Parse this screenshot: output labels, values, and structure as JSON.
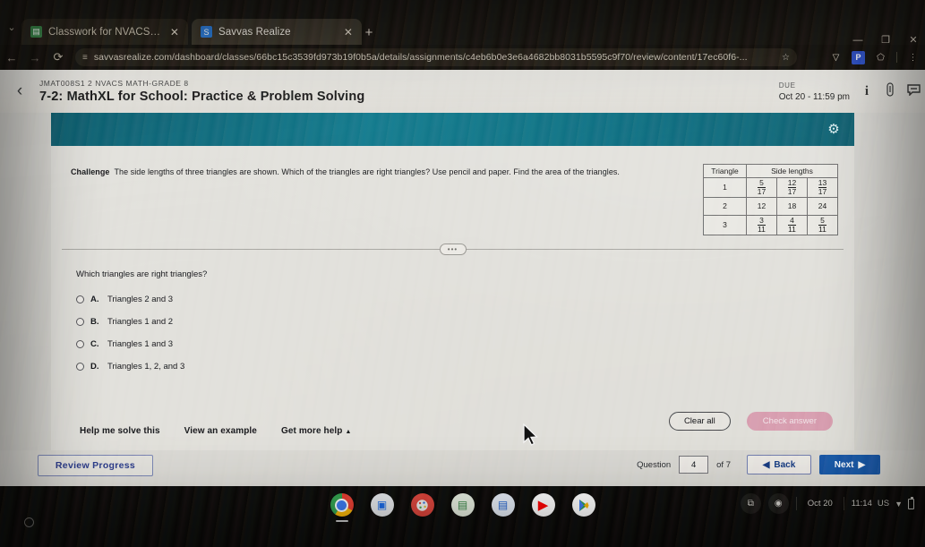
{
  "browser": {
    "tab_list_chevron": "⌄",
    "tabs": [
      {
        "title": "Classwork for NVACS Math-G",
        "favicon": "classroom-icon",
        "close": "✕",
        "active": false
      },
      {
        "title": "Savvas Realize",
        "favicon": "savvas-icon",
        "close": "✕",
        "active": true
      }
    ],
    "new_tab_label": "+",
    "window_controls": {
      "minimize": "—",
      "maximize": "❐",
      "close": "✕"
    },
    "nav": {
      "back": "←",
      "forward": "→",
      "reload": "⟳"
    },
    "url": "savvasrealize.com/dashboard/classes/66bc15c3539fd973b19f0b5a/details/assignments/c4eb6b0e3e6a4682bb8031b5595c9f70/review/content/17ec60f6-...",
    "url_lead_icon": "site-settings-icon",
    "bookmark_star": "☆",
    "extensions": [
      {
        "name": "shield-extension-icon",
        "glyph": "▽"
      },
      {
        "name": "paypal-extension-icon",
        "glyph": "P"
      },
      {
        "name": "puzzle-extensions-icon",
        "glyph": "⬠"
      }
    ],
    "menu_glyph": "⋮"
  },
  "assignment": {
    "back_arrow": "‹",
    "course": "JMAT008S1 2 NVACS MATH-GRADE 8",
    "title": "7-2: MathXL for School: Practice & Problem Solving",
    "due_label": "DUE",
    "due_date": "Oct 20 - 11:59 pm",
    "header_icons": [
      {
        "name": "info-icon",
        "glyph": "i"
      },
      {
        "name": "attachment-icon",
        "glyph": "🖉"
      },
      {
        "name": "comment-icon",
        "glyph": "🗨"
      }
    ],
    "toolbar": {
      "settings_glyph": "⚙",
      "accent_color": "#12788b"
    }
  },
  "exercise": {
    "challenge_label": "Challenge",
    "challenge_text": "The side lengths of three triangles are shown. Which of the triangles are right triangles? Use pencil and paper. Find the area of the triangles.",
    "table": {
      "headers": [
        "Triangle",
        "Side lengths"
      ],
      "rows": [
        {
          "triangle": "1",
          "sides": [
            {
              "num": "5",
              "den": "17"
            },
            {
              "num": "12",
              "den": "17"
            },
            {
              "num": "13",
              "den": "17"
            }
          ]
        },
        {
          "triangle": "2",
          "sides": [
            {
              "num": "12",
              "den": ""
            },
            {
              "num": "18",
              "den": ""
            },
            {
              "num": "24",
              "den": ""
            }
          ]
        },
        {
          "triangle": "3",
          "sides": [
            {
              "num": "3",
              "den": "11"
            },
            {
              "num": "4",
              "den": "11"
            },
            {
              "num": "5",
              "den": "11"
            }
          ]
        }
      ]
    },
    "divider_handle": "•••",
    "question_prompt": "Which triangles are right triangles?",
    "choices": [
      {
        "letter": "A.",
        "text": "Triangles 2 and 3",
        "selected": false
      },
      {
        "letter": "B.",
        "text": "Triangles 1 and 2",
        "selected": false
      },
      {
        "letter": "C.",
        "text": "Triangles 1 and 3",
        "selected": false
      },
      {
        "letter": "D.",
        "text": "Triangles 1, 2, and 3",
        "selected": false
      }
    ],
    "help_links": [
      {
        "label": "Help me solve this"
      },
      {
        "label": "View an example"
      },
      {
        "label": "Get more help"
      }
    ],
    "get_more_help_caret": "▲",
    "clear_all_label": "Clear all",
    "check_answer_label": "Check answer",
    "check_answer_color": "#dba5b6"
  },
  "bottom_nav": {
    "review_progress_label": "Review Progress",
    "question_label": "Question",
    "question_number": "4",
    "of_label": "of 7",
    "back_label": "Back",
    "back_caret": "◀",
    "next_label": "Next",
    "next_caret": "▶",
    "next_color": "#1860ae"
  },
  "shelf": {
    "apps": [
      {
        "name": "chrome-icon",
        "glyph": ""
      },
      {
        "name": "google-meet-icon",
        "glyph": "▣"
      },
      {
        "name": "paint-app-icon",
        "glyph": "🎨"
      },
      {
        "name": "google-classroom-icon",
        "glyph": "▤"
      },
      {
        "name": "google-docs-icon",
        "glyph": "▤"
      },
      {
        "name": "youtube-icon",
        "glyph": "▶"
      },
      {
        "name": "play-store-icon",
        "glyph": "▶"
      }
    ],
    "tray": {
      "screen_capture_glyph": "⧉",
      "record_glyph": "◉",
      "date": "Oct 20",
      "time": "11:14",
      "locale": "US",
      "wifi_glyph": "▼",
      "battery_name": "battery-icon"
    },
    "home_indicator": "launcher-circle-icon"
  }
}
